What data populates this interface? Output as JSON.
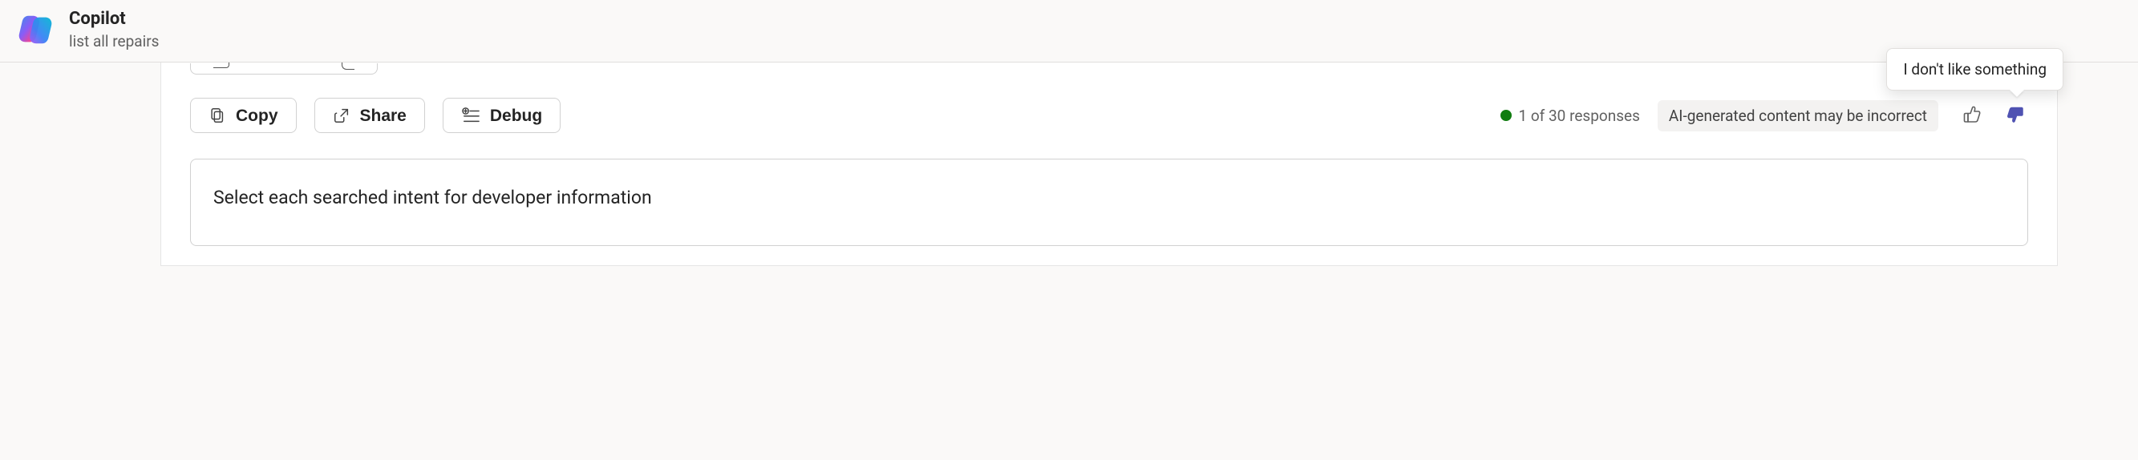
{
  "header": {
    "title": "Copilot",
    "subtitle": "list all repairs"
  },
  "toolbar": {
    "copy_label": "Copy",
    "share_label": "Share",
    "debug_label": "Debug",
    "response_count_text": "1 of 30 responses",
    "ai_notice": "AI-generated content may be incorrect",
    "tooltip_dislike": "I don't like something"
  },
  "content": {
    "intent_prompt": "Select each searched intent for developer information"
  },
  "icons": {
    "logo": "copilot-logo",
    "copy": "copy-icon",
    "share": "share-icon",
    "debug": "debug-icon",
    "status": "status-dot-green",
    "thumbs_up": "thumbs-up-icon",
    "thumbs_down": "thumbs-down-icon"
  },
  "colors": {
    "status_green": "#107c10",
    "thumbs_down_active": "#4f52b2",
    "border": "#d1d1d1",
    "text_primary": "#242424",
    "text_secondary": "#616161",
    "badge_bg": "#f3f2f1"
  }
}
